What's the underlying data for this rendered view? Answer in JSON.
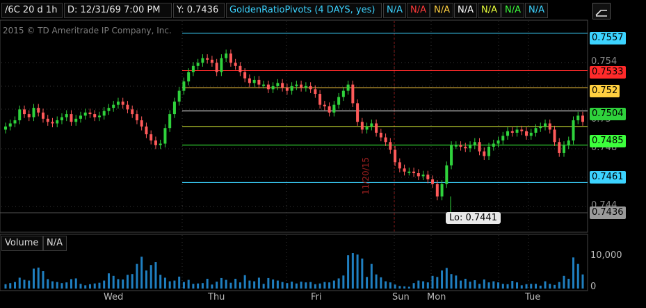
{
  "header": {
    "symbol": "/6C 20 d 1h",
    "date": "D: 12/31/69 7:00 PM",
    "y": "Y: 0.7436",
    "study": "GoldenRatioPivots (4 DAYS, yes)",
    "na_values": [
      {
        "text": "N/A",
        "color": "#3cd3ff"
      },
      {
        "text": "N/A",
        "color": "#ff3a3a"
      },
      {
        "text": "N/A",
        "color": "#ffd040"
      },
      {
        "text": "N/A",
        "color": "#ffffff"
      },
      {
        "text": "N/A",
        "color": "#e8ff3a"
      },
      {
        "text": "N/A",
        "color": "#3cff3c"
      },
      {
        "text": "N/A",
        "color": "#3cd3ff"
      }
    ],
    "icon": "expand-chart-icon"
  },
  "watermark": "2015 © TD Ameritrade IP Company, Inc.",
  "volume_panel": {
    "label": "Volume",
    "value": "N/A",
    "scale_label": "10,000"
  },
  "low_label": "Lo: 0.7441",
  "vertical_date_label": "11/20/15",
  "colors": {
    "up": "#2fd23c",
    "down": "#ff5a5a",
    "grid": "#3a3a3a",
    "volume": "#1f7fc0",
    "background": "#000000"
  },
  "chart_data": {
    "type": "candlestick",
    "x_tick_labels": [
      "Wed",
      "Thu",
      "Fri",
      "Sun",
      "Mon",
      "Tue"
    ],
    "y_tick_labels": [
      "0.754",
      "0.75",
      "0.748",
      "0.744"
    ],
    "price_tags": [
      {
        "value": "0.7557",
        "bg": "#3cd3ff"
      },
      {
        "value": "0.7533",
        "bg": "#ff2a2a"
      },
      {
        "value": "0.752",
        "bg": "#ffd040"
      },
      {
        "value": "0.7504",
        "bg": "#2fd23c"
      },
      {
        "value": "0.7485",
        "bg": "#3cff3c"
      },
      {
        "value": "0.7461",
        "bg": "#3cd3ff"
      },
      {
        "value": "0.7436",
        "bg": "#9a9a9a"
      }
    ],
    "pivot_lines": [
      {
        "value": 0.7557,
        "color": "#3cd3ff"
      },
      {
        "value": 0.7533,
        "color": "#ff2a2a"
      },
      {
        "value": 0.7522,
        "color": "#ffd040"
      },
      {
        "value": 0.7507,
        "color": "#ffffff"
      },
      {
        "value": 0.7497,
        "color": "#e8ff3a"
      },
      {
        "value": 0.7485,
        "color": "#3cff3c"
      },
      {
        "value": 0.7461,
        "color": "#3cd3ff"
      }
    ],
    "ylim": [
      0.7433,
      0.7565
    ],
    "closes": [
      0.7497,
      0.7499,
      0.7501,
      0.7508,
      0.7505,
      0.7503,
      0.7509,
      0.7506,
      0.7502,
      0.75,
      0.7499,
      0.7501,
      0.7503,
      0.7505,
      0.75,
      0.7502,
      0.7504,
      0.7506,
      0.7505,
      0.7503,
      0.7504,
      0.7507,
      0.7509,
      0.7511,
      0.7513,
      0.7511,
      0.7508,
      0.7505,
      0.7501,
      0.7497,
      0.7492,
      0.7488,
      0.7485,
      0.7486,
      0.7496,
      0.7505,
      0.7513,
      0.752,
      0.7526,
      0.7532,
      0.7536,
      0.7538,
      0.7541,
      0.754,
      0.7538,
      0.7532,
      0.7541,
      0.7544,
      0.7538,
      0.7536,
      0.7532,
      0.7528,
      0.7525,
      0.7527,
      0.7524,
      0.7524,
      0.7521,
      0.7523,
      0.7525,
      0.7522,
      0.752,
      0.7523,
      0.7524,
      0.7522,
      0.7523,
      0.7521,
      0.7518,
      0.7511,
      0.751,
      0.7506,
      0.7511,
      0.7516,
      0.752,
      0.7524,
      0.7512,
      0.75,
      0.7495,
      0.7497,
      0.7499,
      0.7493,
      0.749,
      0.7487,
      0.7482,
      0.7474,
      0.747,
      0.7468,
      0.7468,
      0.7467,
      0.7465,
      0.7466,
      0.7463,
      0.746,
      0.7452,
      0.746,
      0.7472,
      0.7485,
      0.7485,
      0.7484,
      0.7483,
      0.7485,
      0.7487,
      0.7481,
      0.7478,
      0.7484,
      0.7486,
      0.7488,
      0.7491,
      0.7494,
      0.7493,
      0.7495,
      0.7494,
      0.7491,
      0.7493,
      0.7496,
      0.7497,
      0.7499,
      0.7495,
      0.7487,
      0.748,
      0.7485,
      0.7488,
      0.7501,
      0.7504,
      0.75
    ],
    "volumes": [
      1200,
      1500,
      1800,
      3000,
      2400,
      2200,
      5500,
      5800,
      4800,
      2600,
      2000,
      1800,
      1500,
      1700,
      2600,
      2800,
      1300,
      900,
      1200,
      1400,
      1600,
      2200,
      4200,
      3500,
      2600,
      2500,
      3800,
      4000,
      6800,
      8800,
      5000,
      6500,
      7300,
      3800,
      3000,
      2000,
      2200,
      3300,
      1800,
      2400,
      1300,
      1400,
      1500,
      2700,
      1100,
      1900,
      2900,
      2400,
      1600,
      2700,
      1700,
      3700,
      2200,
      2000,
      3000,
      1300,
      2900,
      2500,
      2200,
      1800,
      1500,
      1900,
      1400,
      1900,
      1700,
      1800,
      1200,
      1400,
      1800,
      1700,
      2200,
      2800,
      3600,
      9200,
      9800,
      9400,
      8300,
      3200,
      6800,
      3900,
      3100,
      2000,
      1700,
      1100,
      700,
      600,
      500,
      1500,
      2200,
      2000,
      1700,
      3500,
      3200,
      5000,
      5700,
      4000,
      3600,
      2200,
      2700,
      1900,
      2300,
      1300,
      2500,
      1700,
      2000,
      1700,
      1300,
      1200,
      2100,
      1700,
      900,
      1200,
      1300,
      1300,
      800,
      2000,
      1300,
      1000,
      1800,
      3500,
      2700,
      8600,
      6800,
      3900
    ]
  }
}
